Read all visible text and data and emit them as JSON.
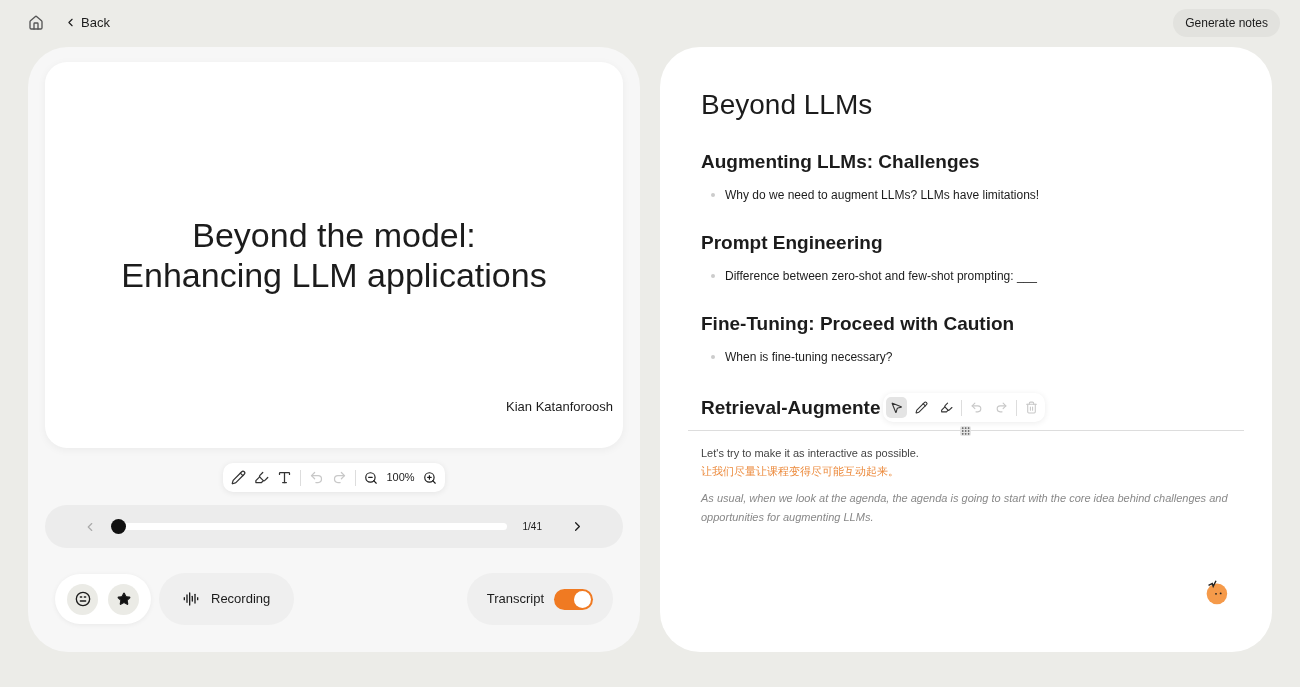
{
  "top_bar": {
    "back": "Back",
    "generate": "Generate notes"
  },
  "slide": {
    "title_lines": [
      "Beyond the model:",
      "Enhancing LLM applications"
    ],
    "author": "Kian Katanforoosh"
  },
  "slide_toolbar": {
    "tools": [
      {
        "kind": "pen",
        "disabled": false
      },
      {
        "kind": "eraser",
        "disabled": false
      },
      {
        "kind": "text",
        "disabled": false
      },
      {
        "kind": "undo",
        "disabled": true
      },
      {
        "kind": "redo",
        "disabled": true
      }
    ],
    "zoom": "100%"
  },
  "pager": {
    "level": 0,
    "page": "1/41"
  },
  "controls": {
    "recording": "Recording",
    "transcript": {
      "label": "Transcript",
      "on": true
    }
  },
  "notes": {
    "title": "Beyond LLMs",
    "sections": [
      {
        "heading": "Augmenting LLMs: Challenges",
        "bullets": [
          "Why do we need to augment LLMs? LLMs have limitations!"
        ]
      },
      {
        "heading": "Prompt Engineering",
        "bullets": [
          "Difference between zero-shot and few-shot prompting: ___"
        ]
      },
      {
        "heading": "Fine-Tuning: Proceed with Caution",
        "bullets": [
          "When is fine-tuning necessary?"
        ]
      },
      {
        "heading": "Retrieval-Augmente"
      }
    ]
  },
  "notes_toolbar": {
    "tools": [
      {
        "kind": "pointer",
        "selected": true,
        "disabled": false
      },
      {
        "kind": "pen",
        "selected": false,
        "disabled": false
      },
      {
        "kind": "eraser",
        "selected": false,
        "disabled": false
      },
      {
        "kind": "undo",
        "selected": false,
        "disabled": true
      },
      {
        "kind": "redo",
        "selected": false,
        "disabled": true
      },
      {
        "kind": "trash",
        "selected": false,
        "disabled": true
      }
    ]
  },
  "transcript": {
    "english": "Let's try to make it as interactive as possible.",
    "chinese": "让我们尽量让课程变得尽可能互动起来。",
    "next": "As usual, when we look at the agenda, the agenda is going to start with the core idea behind challenges and opportunities for augmenting LLMs."
  }
}
